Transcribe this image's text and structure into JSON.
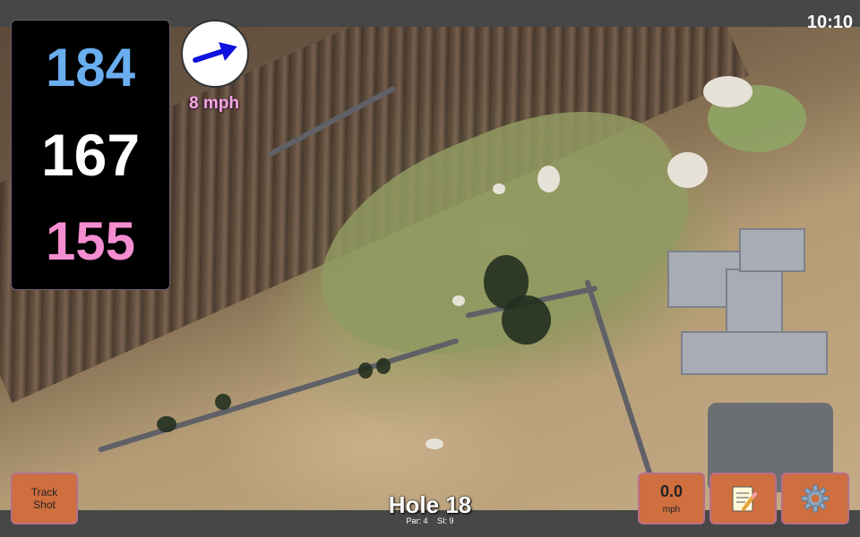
{
  "status": {
    "time": "10:10"
  },
  "distances": {
    "back": "184",
    "middle": "167",
    "front": "155"
  },
  "wind": {
    "speed": "8 mph",
    "direction_icon": "wind-arrow-icon"
  },
  "hole": {
    "title": "Hole 18",
    "par": "Par: 4",
    "si": "SI: 9"
  },
  "buttons": {
    "track_shot_line1": "Track",
    "track_shot_line2": "Shot",
    "speed_value": "0.0",
    "speed_unit": "mph",
    "notes_icon": "notepad-icon",
    "settings_icon": "gear-icon"
  },
  "colors": {
    "back": "#6aaef0",
    "middle": "#ffffff",
    "front": "#f58ed0",
    "button": "#cf6e3f",
    "wind_arrow": "#1010e0"
  }
}
